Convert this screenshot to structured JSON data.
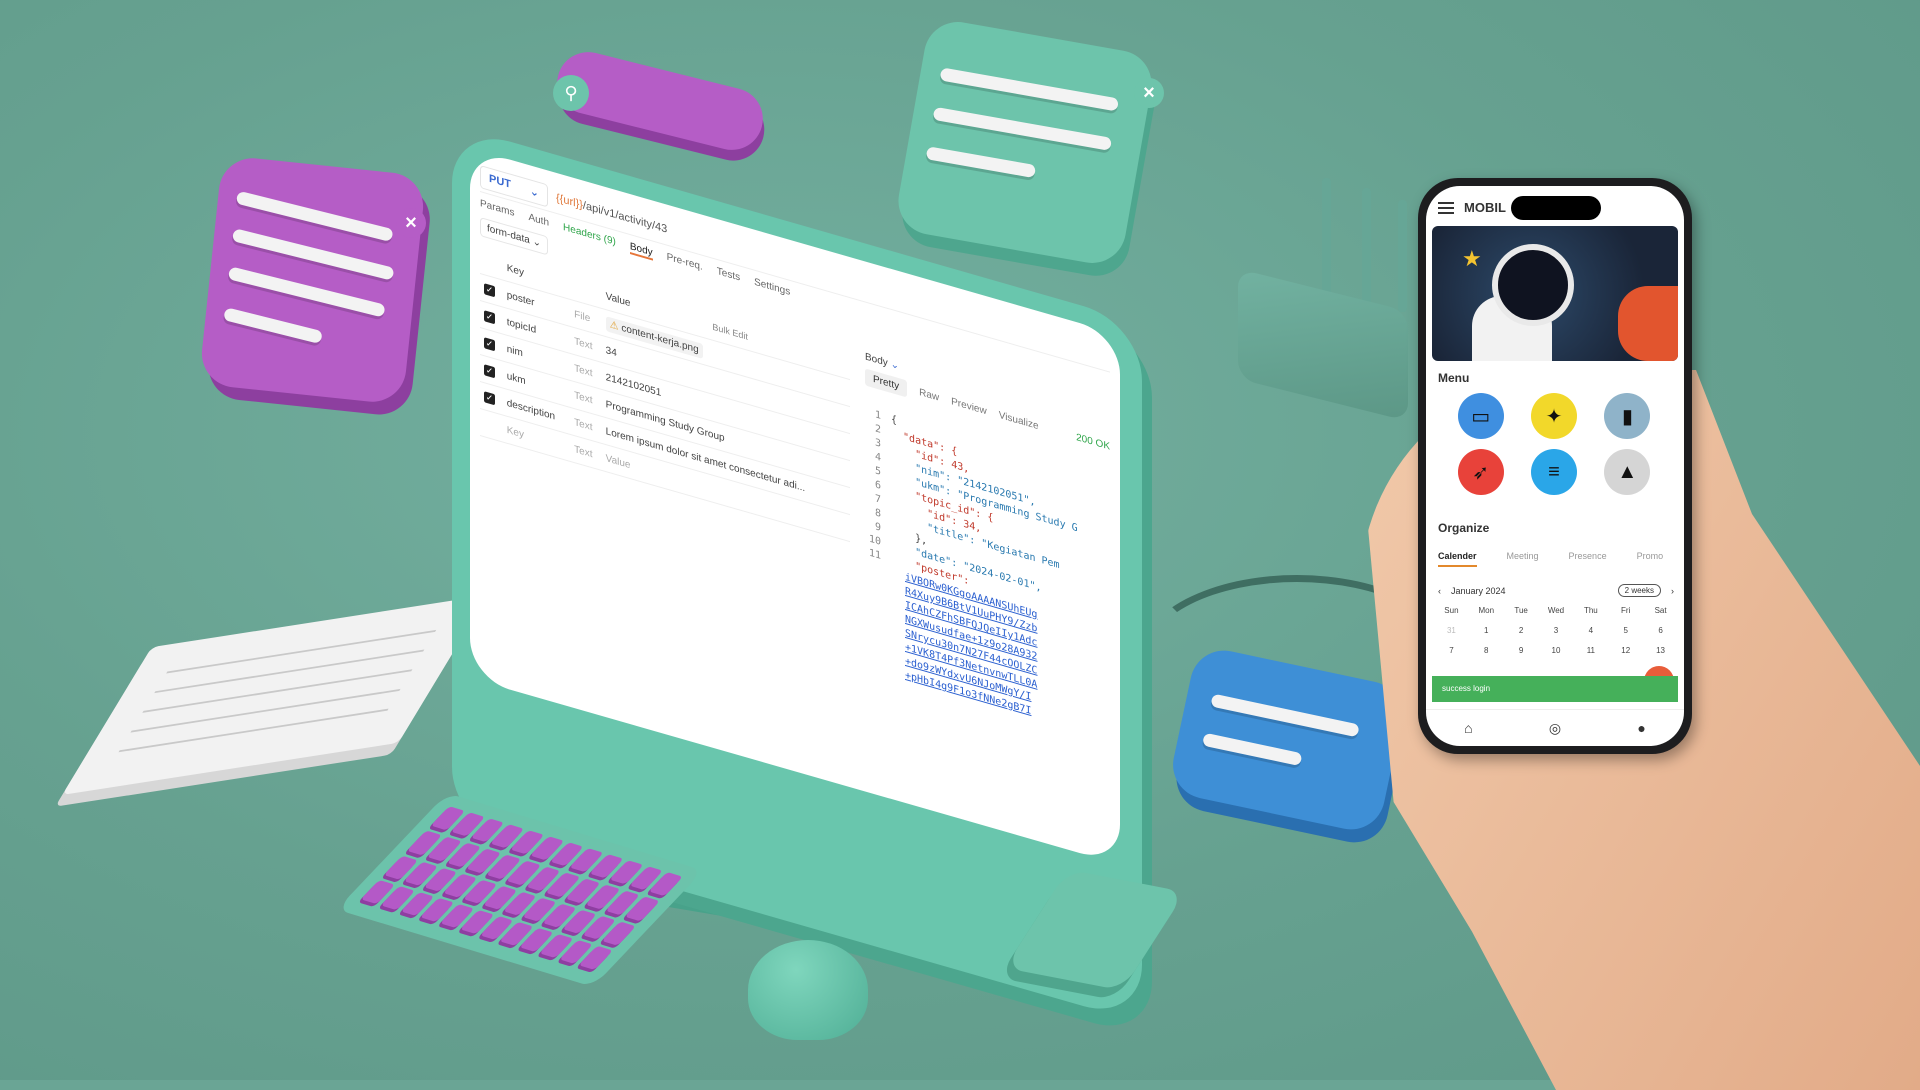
{
  "postman": {
    "method": "PUT",
    "url_var": "{{url}}",
    "url_path": "/api/v1/activity/43",
    "req_tabs": [
      "Params",
      "Auth",
      "Headers (9)",
      "Body",
      "Pre-req.",
      "Tests",
      "Settings"
    ],
    "body_type": "form-data",
    "key_header": "Key",
    "value_header": "Value",
    "bulk_edit": "Bulk Edit",
    "rows": [
      {
        "key": "poster",
        "type": "File",
        "value": "content-kerja.png"
      },
      {
        "key": "topicId",
        "type": "Text",
        "value": "34"
      },
      {
        "key": "nim",
        "type": "Text",
        "value": "2142102051"
      },
      {
        "key": "ukm",
        "type": "Text",
        "value": "Programming Study Group"
      },
      {
        "key": "description",
        "type": "Text",
        "value": "Lorem ipsum dolor sit amet consectetur adi..."
      }
    ],
    "new_key_placeholder": "Key",
    "new_type": "Text",
    "new_value_placeholder": "Value",
    "resp_label": "Body",
    "resp_tabs": [
      "Pretty",
      "Raw",
      "Preview",
      "Visualize"
    ],
    "status": "200 OK",
    "code_lines": [
      "{",
      "  \"data\": {",
      "    \"id\": 43,",
      "    \"nim\": \"2142102051\",",
      "    \"ukm\": \"Programming Study G",
      "    \"topic_id\": {",
      "      \"id\": 34,",
      "      \"title\": \"Kegiatan Pem",
      "    },",
      "    \"date\": \"2024-02-01\",",
      "    \"poster\":"
    ],
    "poster_lines": [
      "iVBORw0KGgoAAAANSUhEUg",
      "R4Xuy9B6BtV1UuPHY9/Zzb",
      "ICAhCZFhSBFQJQeIIy1Adc",
      "NGXWusudfae+1z9o28A932",
      "SNrycu30n7N27F44cOOLZC",
      "+1VK8T4Pf3NetnvnwTLL0A",
      "+do9zWYdxvU6NJoMWgY/I",
      "+pHbI4g9F1o3fNNe2gB7I"
    ]
  },
  "phone": {
    "app_title": "MOBIL",
    "menu_title": "Menu",
    "menu_items": [
      {
        "icon": "laptop-icon",
        "color": "#3f8fe0"
      },
      {
        "icon": "sparkle-chart-icon",
        "color": "#f2d82a"
      },
      {
        "icon": "book-icon",
        "color": "#8fb3c9"
      },
      {
        "icon": "run-icon",
        "color": "#e8423a"
      },
      {
        "icon": "playlist-icon",
        "color": "#2aa6e8"
      },
      {
        "icon": "mountain-icon",
        "color": "#d5d5d5"
      }
    ],
    "organize_title": "Organize",
    "tabs": [
      "Calender",
      "Meeting",
      "Presence",
      "Promo"
    ],
    "month": "January 2024",
    "range_pill": "2 weeks",
    "weekdays": [
      "Sun",
      "Mon",
      "Tue",
      "Wed",
      "Thu",
      "Fri",
      "Sat"
    ],
    "week1": [
      "31",
      "1",
      "2",
      "3",
      "4",
      "5",
      "6"
    ],
    "week2": [
      "7",
      "8",
      "9",
      "10",
      "11",
      "12",
      "13"
    ],
    "toast": "success login"
  }
}
